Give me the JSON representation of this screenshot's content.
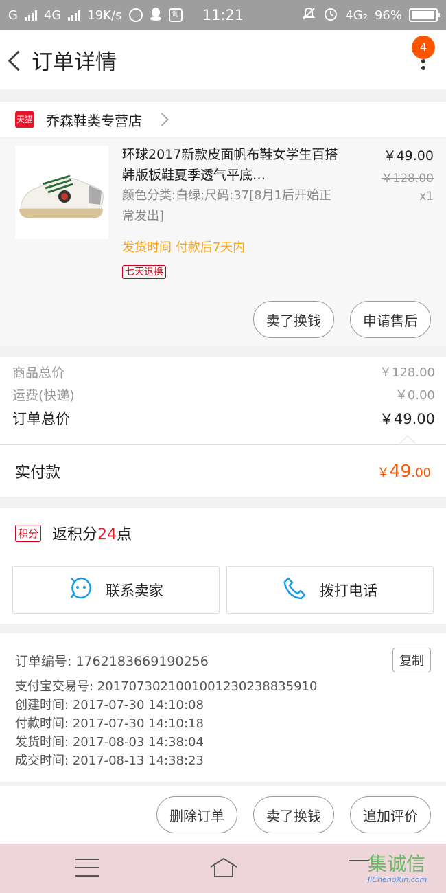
{
  "status_bar": {
    "network_1": "G",
    "network_2": "4G",
    "speed": "19K/s",
    "taobao_icon_text": "淘",
    "time": "11:21",
    "network_3": "4G₂",
    "battery": "96%"
  },
  "header": {
    "title": "订单详情",
    "notification_count": "4"
  },
  "store": {
    "badge": "天猫",
    "name": "乔森鞋类专营店"
  },
  "item": {
    "title": "环球2017新款皮面帆布鞋女学生百搭韩版板鞋夏季透气平底…",
    "sku": "颜色分类:白绿;尺码:37[8月1后开始正常发出]",
    "price_now": "￥49.00",
    "price_old": "￥128.00",
    "quantity": "x1",
    "ship_time": "发货时间 付款后7天内",
    "refund_tag": "七天退换",
    "actions": {
      "sell": "卖了换钱",
      "after_sale": "申请售后"
    }
  },
  "totals": {
    "goods_label": "商品总价",
    "goods_value": "￥128.00",
    "shipping_label": "运费(快递)",
    "shipping_value": "￥0.00",
    "order_label": "订单总价",
    "order_value": "￥49.00"
  },
  "payment": {
    "label": "实付款",
    "currency": "￥",
    "amount": "49",
    "cents": ".00"
  },
  "points": {
    "tag": "积分",
    "prefix": "返积分",
    "value": "24",
    "suffix": "点"
  },
  "contact": {
    "seller": "联系卖家",
    "call": "拨打电话"
  },
  "order_info": {
    "number": "订单编号: 1762183669190256",
    "copy": "复制",
    "lines": [
      "支付宝交易号: 2017073021001001230238835910",
      "创建时间: 2017-07-30  14:10:08",
      "付款时间: 2017-07-30  14:10:18",
      "发货时间: 2017-08-03  14:38:04",
      "成交时间: 2017-08-13  14:38:23"
    ]
  },
  "bottom_actions": {
    "delete": "删除订单",
    "sell": "卖了换钱",
    "review": "追加评价"
  },
  "watermark": {
    "text": "集诚信",
    "url": "JiChengXin.com"
  },
  "colors": {
    "accent": "#ff5500",
    "tmall_red": "#e5152a",
    "ship_time": "#f5a623",
    "contact_icon": "#1a9be6"
  }
}
